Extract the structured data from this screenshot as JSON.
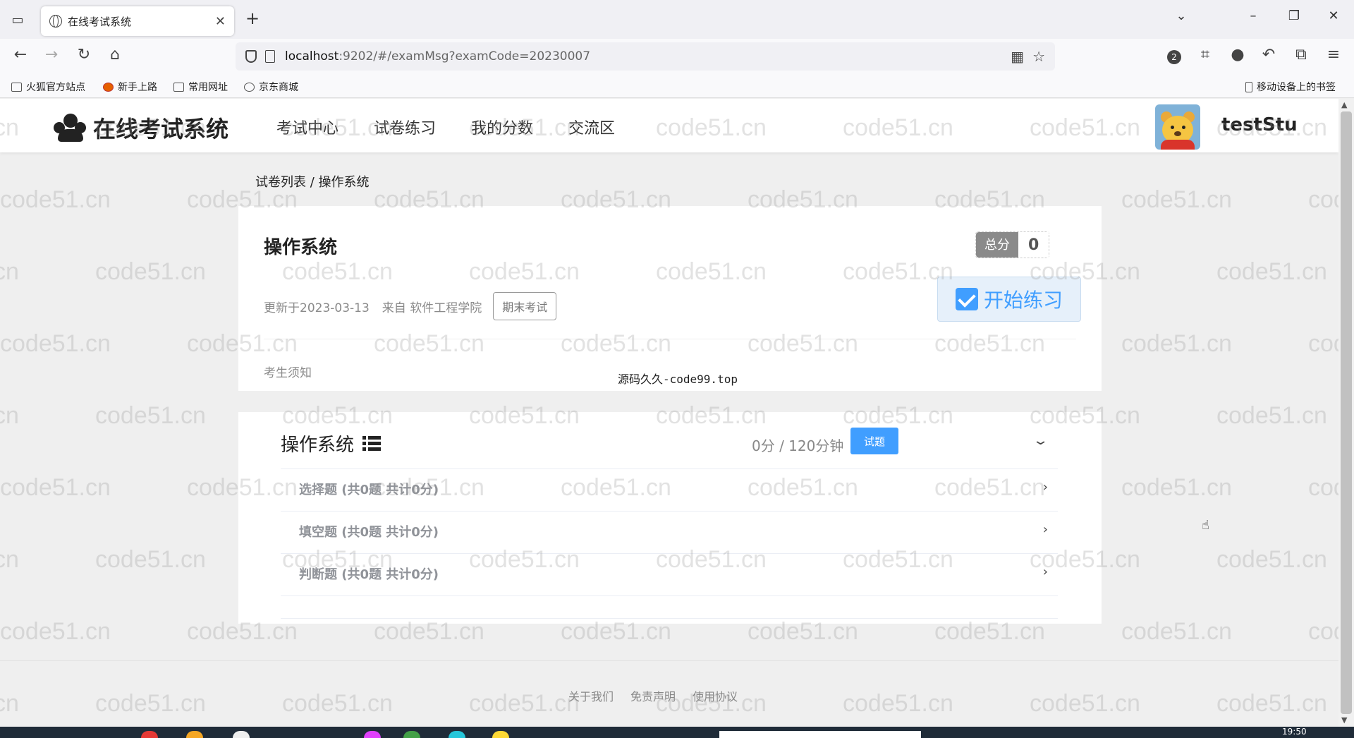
{
  "browser": {
    "tab_title": "在线考试系统",
    "url_host": "localhost",
    "url_rest": ":9202/#/examMsg?examCode=20230007",
    "badge_count": "2",
    "bookmarks": [
      "火狐官方站点",
      "新手上路",
      "常用网址",
      "京东商城"
    ],
    "mobile_bookmarks": "移动设备上的书签"
  },
  "site": {
    "logo_text": "在线考试系统",
    "menu": [
      "考试中心",
      "试卷练习",
      "我的分数",
      "交流区"
    ],
    "username": "testStu"
  },
  "breadcrumb": "试卷列表 / 操作系统",
  "exam": {
    "title": "操作系统",
    "total_label": "总分",
    "total_value": "0",
    "updated": "更新于2023-03-13",
    "source": "来自 软件工程学院",
    "tag": "期末考试",
    "start_button": "开始练习",
    "notice_label": "考生须知",
    "notice_text": "源码久久-code99.top"
  },
  "paper": {
    "title": "操作系统",
    "score_time": "0分 / 120分钟",
    "try_button": "试题",
    "sections": [
      "选择题 (共0题 共计0分)",
      "填空题 (共0题 共计0分)",
      "判断题 (共0题 共计0分)"
    ]
  },
  "footer": [
    "关于我们",
    "免责声明",
    "使用协议"
  ],
  "watermark": "code51.cn",
  "clock": "19:50",
  "colors": {
    "primary": "#409eff",
    "total_label_bg": "#8a8a8a",
    "section_text": "#909399"
  }
}
